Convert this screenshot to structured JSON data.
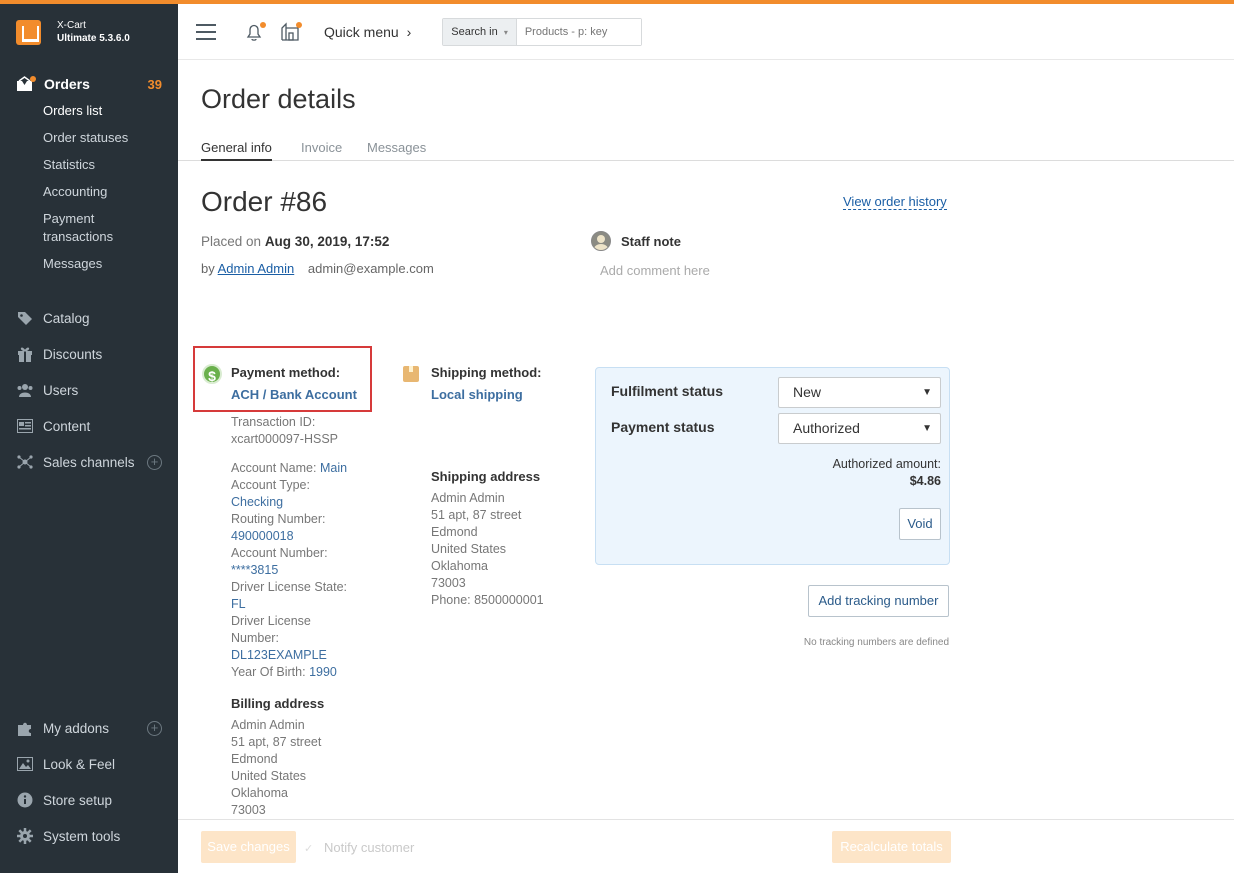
{
  "brand": {
    "line1": "X-Cart",
    "line2": "Ultimate 5.3.6.0",
    "logo_icon": "x-cart-logo"
  },
  "sidebar": {
    "orders": {
      "label": "Orders",
      "count": "39",
      "icon": "orders-icon"
    },
    "order_subitems": [
      {
        "label": "Orders list",
        "active": true
      },
      {
        "label": "Order statuses"
      },
      {
        "label": "Statistics"
      },
      {
        "label": "Accounting"
      },
      {
        "label": "Payment transactions"
      },
      {
        "label": "Messages"
      }
    ],
    "items": [
      {
        "label": "Catalog",
        "icon": "tag-icon"
      },
      {
        "label": "Discounts",
        "icon": "gift-icon"
      },
      {
        "label": "Users",
        "icon": "users-icon"
      },
      {
        "label": "Content",
        "icon": "content-icon"
      },
      {
        "label": "Sales channels",
        "icon": "network-icon"
      }
    ],
    "bottom_items": [
      {
        "label": "My addons",
        "icon": "puzzle-icon"
      },
      {
        "label": "Look & Feel",
        "icon": "image-icon"
      },
      {
        "label": "Store setup",
        "icon": "info-icon"
      },
      {
        "label": "System tools",
        "icon": "gear-icon"
      }
    ]
  },
  "header": {
    "quick_menu": "Quick menu",
    "search_in": "Search in",
    "search_placeholder": "Products - p: key"
  },
  "page": {
    "title": "Order details",
    "tabs": [
      "General info",
      "Invoice",
      "Messages"
    ]
  },
  "order": {
    "title": "Order #86",
    "view_history": "View order history",
    "placed_prefix": "Placed on",
    "placed_date": "Aug 30, 2019, 17:52",
    "by": "by",
    "user_name": "Admin Admin",
    "user_email": "admin@example.com",
    "staff_note_label": "Staff note",
    "staff_note_placeholder": "Add comment here"
  },
  "payment": {
    "label": "Payment method:",
    "method": "ACH / Bank Account",
    "transaction_label": "Transaction ID:",
    "transaction_id": "xcart000097-HSSP",
    "account_name_label": "Account Name:",
    "account_name": "Main",
    "account_type_label": "Account Type:",
    "account_type": "Checking",
    "routing_label": "Routing Number:",
    "routing": "490000018",
    "account_number_label": "Account Number:",
    "account_number": "****3815",
    "license_state_label": "Driver License State:",
    "license_state": "FL",
    "license_number_label_1": "Driver License",
    "license_number_label_2": "Number:",
    "license_number": "DL123EXAMPLE",
    "birth_label": "Year Of Birth:",
    "birth": "1990"
  },
  "billing": {
    "label": "Billing address",
    "lines": [
      "Admin Admin",
      "51 apt, 87 street",
      "Edmond",
      "United States",
      "Oklahoma",
      "73003"
    ]
  },
  "shipping": {
    "label": "Shipping method:",
    "method": "Local shipping",
    "address_label": "Shipping address",
    "lines": [
      "Admin Admin",
      "51 apt, 87 street",
      "Edmond",
      "United States",
      "Oklahoma",
      "73003",
      "Phone: 8500000001"
    ]
  },
  "status": {
    "fulfilment_label": "Fulfilment status",
    "fulfilment_value": "New",
    "payment_label": "Payment status",
    "payment_value": "Authorized",
    "authorized_label": "Authorized amount:",
    "authorized_amount": "$4.86",
    "void": "Void"
  },
  "tracking": {
    "add": "Add tracking number",
    "empty": "No tracking numbers are defined"
  },
  "footer": {
    "save": "Save changes",
    "notify": "Notify customer",
    "recalculate": "Recalculate totals"
  }
}
